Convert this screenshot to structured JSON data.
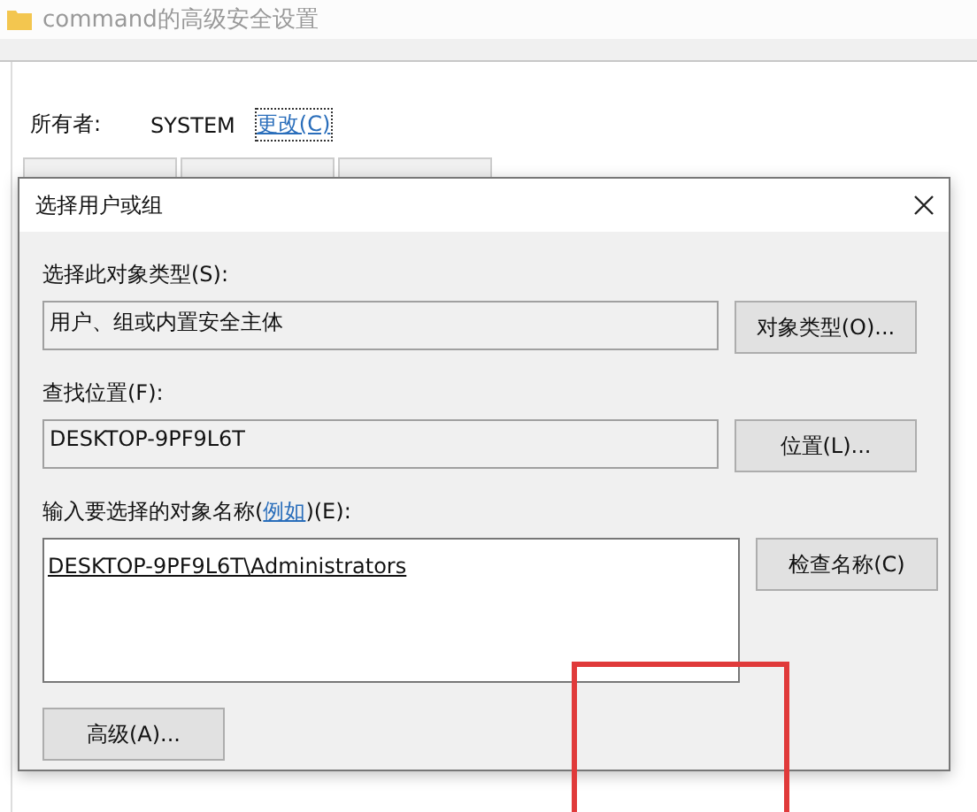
{
  "window": {
    "title": "command的高级安全设置"
  },
  "owner": {
    "label": "所有者:",
    "value": "SYSTEM",
    "link": "更改(C)"
  },
  "dialog": {
    "title": "选择用户或组",
    "object_type": {
      "label": "选择此对象类型(S):",
      "value": "用户、组或内置安全主体",
      "button": "对象类型(O)..."
    },
    "location": {
      "label": "查找位置(F):",
      "value": "DESKTOP-9PF9L6T",
      "button": "位置(L)..."
    },
    "names": {
      "label_before": "输入要选择的对象名称(",
      "link": "例如",
      "label_after": ")(E):",
      "value": "DESKTOP-9PF9L6T\\Administrators",
      "button": "检查名称(C)"
    },
    "advanced_button": "高级(A)..."
  },
  "highlight": {
    "kind": "box",
    "color": "#e03a3a"
  }
}
